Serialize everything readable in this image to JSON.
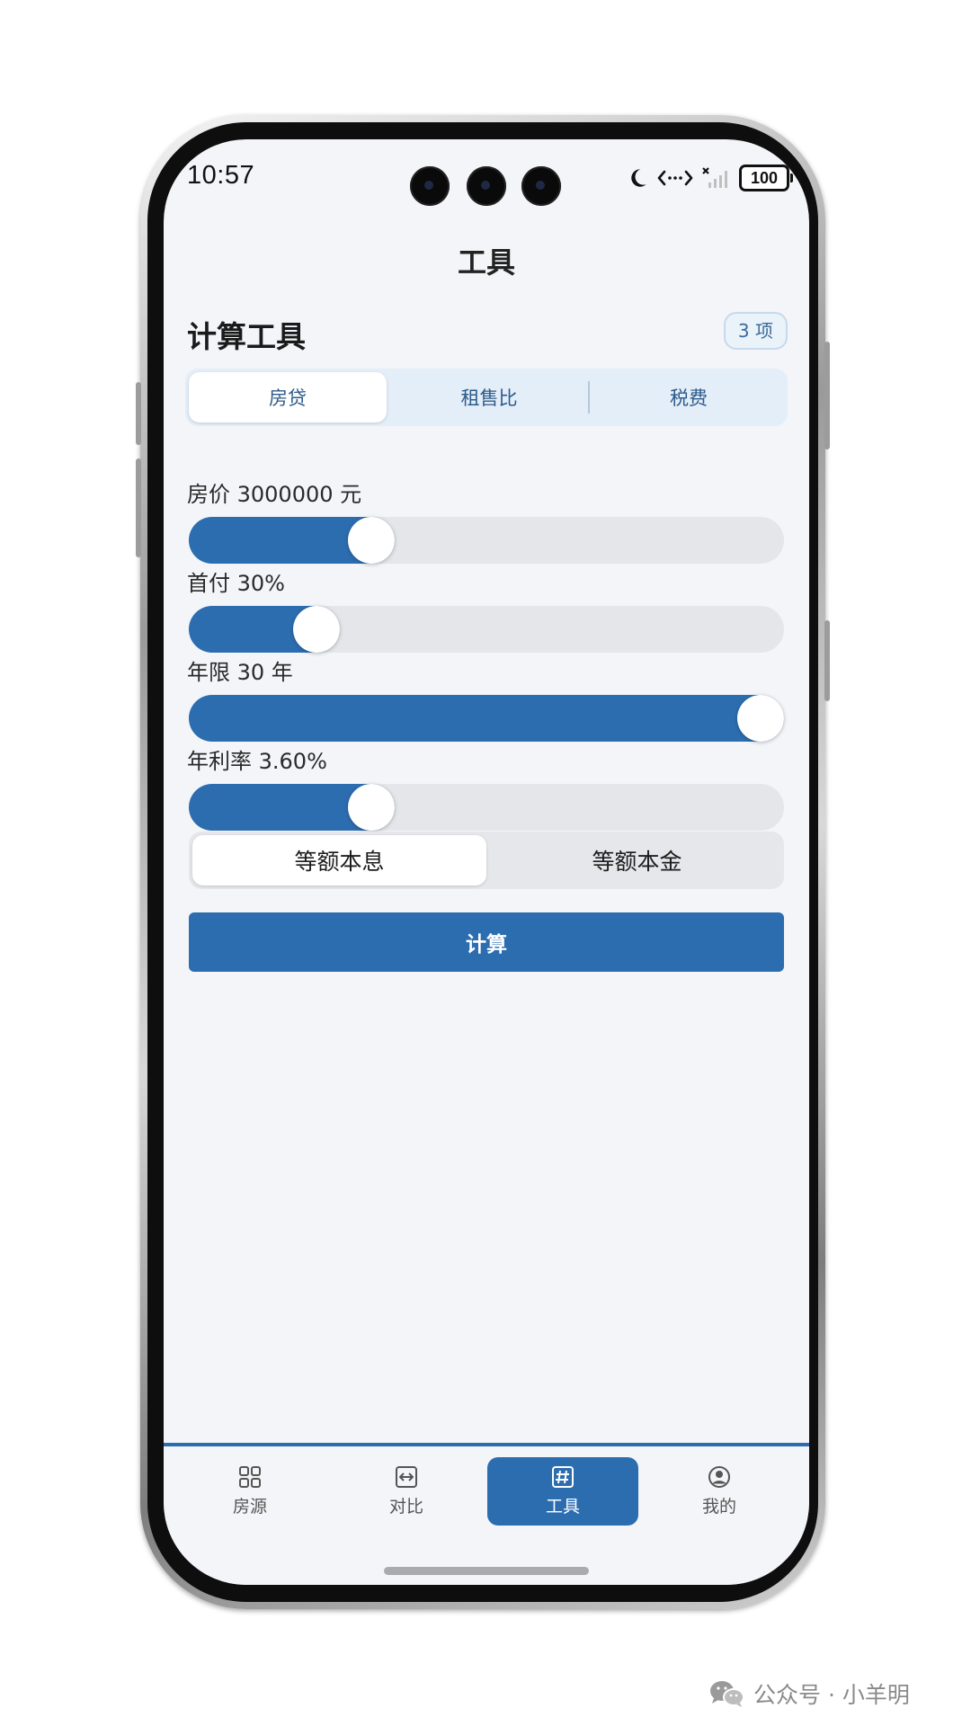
{
  "status_bar": {
    "time": "10:57",
    "battery": "100"
  },
  "header": {
    "title": "工具"
  },
  "section": {
    "title": "计算工具",
    "count_badge": "3 项"
  },
  "tabs": [
    {
      "label": "房贷",
      "active": true
    },
    {
      "label": "租售比",
      "active": false
    },
    {
      "label": "税费",
      "active": false
    }
  ],
  "sliders": [
    {
      "label": "房价 3000000 元",
      "fill": 0.29
    },
    {
      "label": "首付 30%",
      "fill": 0.19
    },
    {
      "label": "年限 30 年",
      "fill": 1.0
    },
    {
      "label": "年利率 3.60%",
      "fill": 0.29
    }
  ],
  "repayment": {
    "options": [
      {
        "label": "等额本息",
        "active": true
      },
      {
        "label": "等额本金",
        "active": false
      }
    ]
  },
  "calculate_button": "计算",
  "bottom_nav": [
    {
      "label": "房源",
      "icon": "grid-icon",
      "active": false
    },
    {
      "label": "对比",
      "icon": "compare-icon",
      "active": false
    },
    {
      "label": "工具",
      "icon": "hash-icon",
      "active": true
    },
    {
      "label": "我的",
      "icon": "profile-icon",
      "active": false
    }
  ],
  "watermark": {
    "text": "公众号 · 小羊明"
  },
  "colors": {
    "accent": "#2c6db0",
    "background": "#f3f5f8",
    "track": "#e5e6e9"
  }
}
